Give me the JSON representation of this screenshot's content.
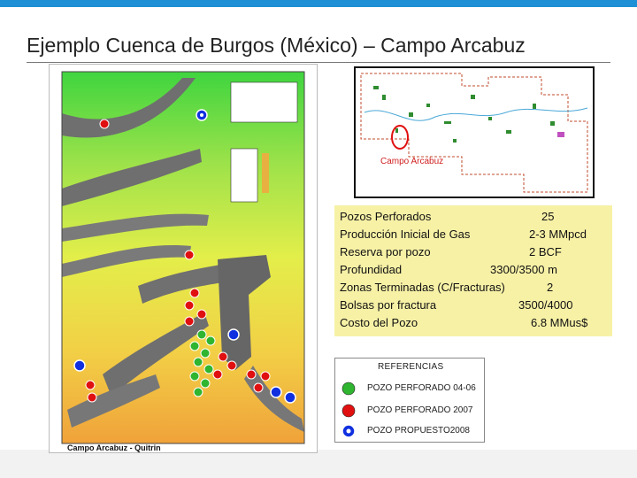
{
  "slide": {
    "title": "Ejemplo Cuenca de Burgos (México) – Campo Arcabuz",
    "accent_color": "#1f8fd6"
  },
  "map": {
    "footer_label": "Campo Arcabuz - Quitrin",
    "inset_field_label": "Campo Arcabuz"
  },
  "info_box": {
    "background": "#f7f1a6",
    "rows": [
      {
        "label": "Pozos Perforados",
        "value": "25"
      },
      {
        "label": "Producción Inicial de Gas",
        "value": "2-3 MMpcd"
      },
      {
        "label": "Reserva por pozo",
        "value": "2 BCF"
      },
      {
        "label": "Profundidad",
        "value": "3300/3500 m"
      },
      {
        "label": "Zonas Terminadas (C/Fracturas)",
        "value": "2"
      },
      {
        "label": "Bolsas por fractura",
        "value": "3500/4000"
      },
      {
        "label": "Costo del Pozo",
        "value": "6.8 MMus$"
      }
    ]
  },
  "legend": {
    "title": "REFERENCIAS",
    "items": [
      {
        "label": "POZO PERFORADO 04-06",
        "color": "#2fb52f",
        "icon": "green-circle-icon"
      },
      {
        "label": "POZO  PERFORADO 2007",
        "color": "#e01010",
        "icon": "red-circle-icon"
      },
      {
        "label": "POZO PROPUESTO2008",
        "color": "#1030e0",
        "icon": "blue-circle-icon"
      }
    ]
  }
}
